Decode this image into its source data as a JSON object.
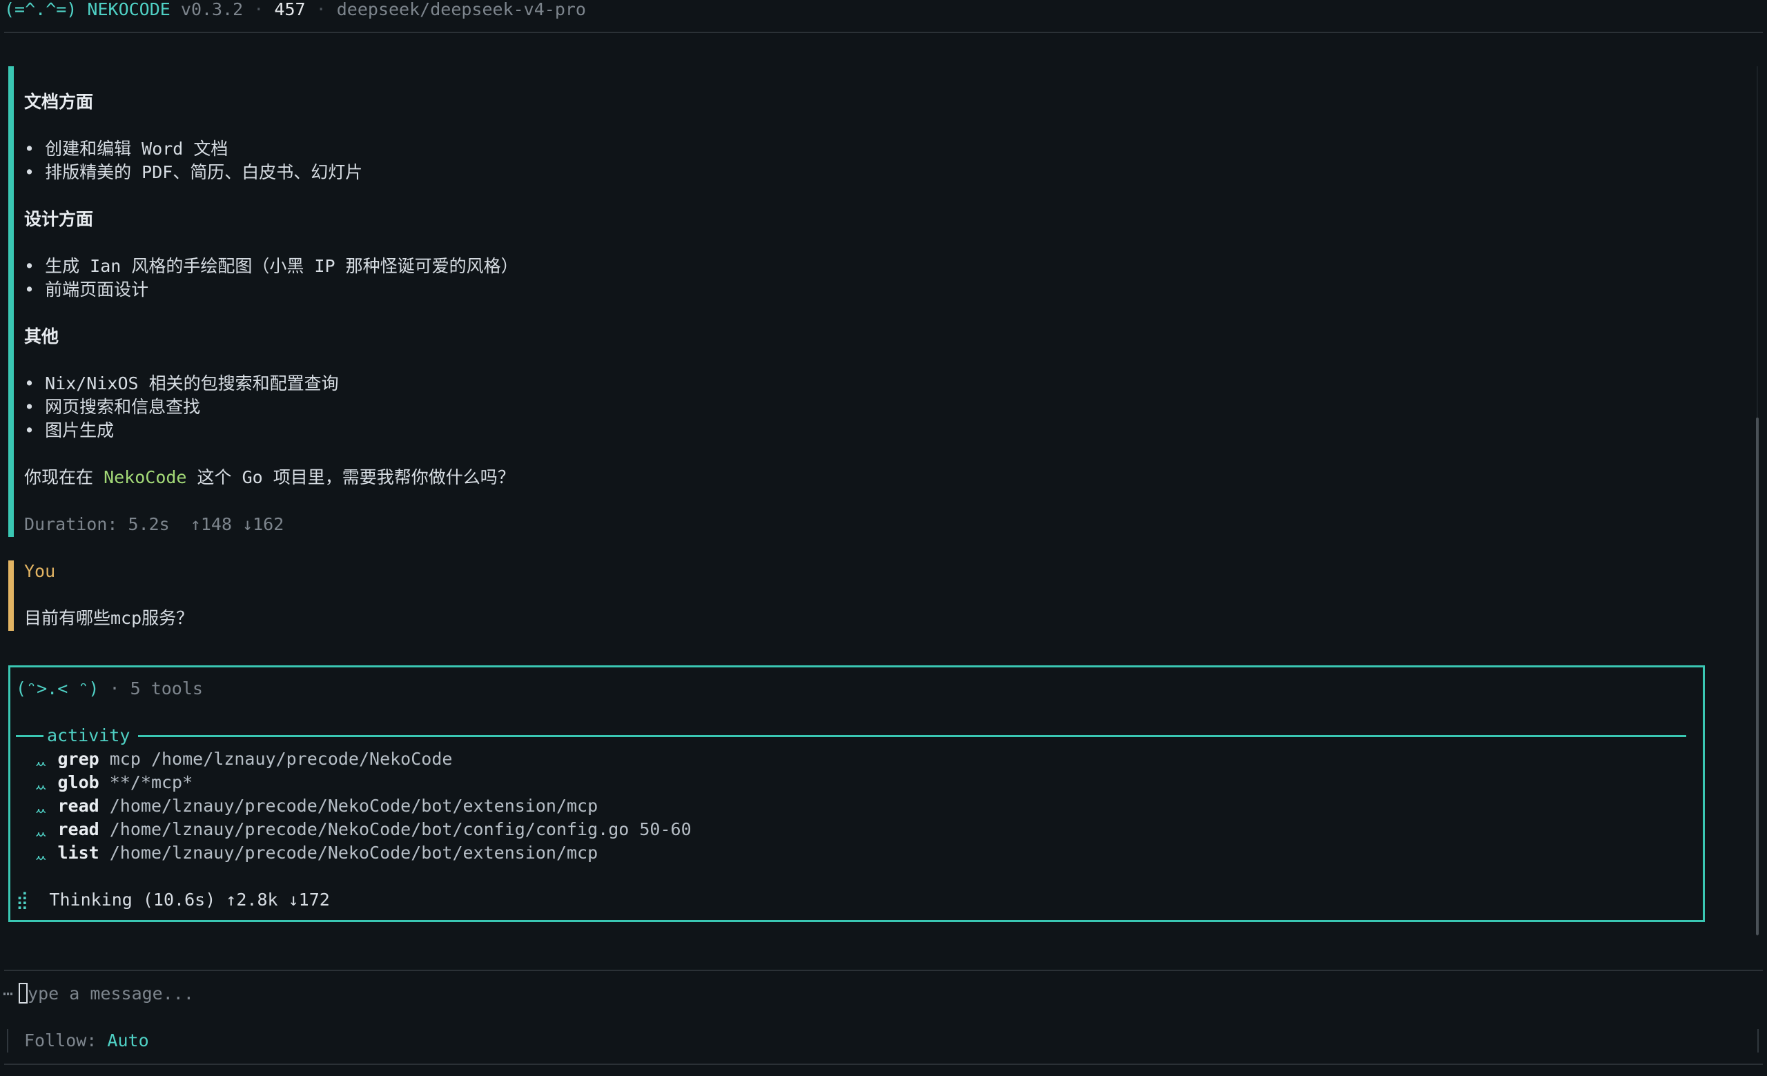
{
  "header": {
    "face": "(=^.^=)",
    "brand": "NEKOCODE",
    "version": "v0.3.2",
    "separator": "·",
    "count": "457",
    "model": "deepseek/deepseek-v4-pro"
  },
  "assistant_message": {
    "sections": [
      {
        "title": "文档方面",
        "items": [
          "• 创建和编辑 Word 文档",
          "• 排版精美的 PDF、简历、白皮书、幻灯片"
        ]
      },
      {
        "title": "设计方面",
        "items": [
          "• 生成 Ian 风格的手绘配图（小黑 IP 那种怪诞可爱的风格）",
          "• 前端页面设计"
        ]
      },
      {
        "title": "其他",
        "items": [
          "• Nix/NixOS 相关的包搜索和配置查询",
          "• 网页搜索和信息查找",
          "• 图片生成"
        ]
      }
    ],
    "closing_prefix": "你现在在 ",
    "closing_highlight": "NekoCode",
    "closing_suffix": " 这个 Go 项目里，需要我帮你做什么吗？",
    "duration": "Duration: 5.2s  ↑148 ↓162"
  },
  "user_message": {
    "author": "You",
    "text": "目前有哪些mcp服务？"
  },
  "activity_panel": {
    "face": "(ᵔ>.< ᵔ)",
    "tools_summary": "· 5 tools",
    "title": "activity",
    "tool_icon": "ᆻ",
    "tools": [
      {
        "name": "grep",
        "args": "mcp /home/lznauy/precode/NekoCode"
      },
      {
        "name": "glob",
        "args": "**/*mcp*"
      },
      {
        "name": "read",
        "args": "/home/lznauy/precode/NekoCode/bot/extension/mcp"
      },
      {
        "name": "read",
        "args": "/home/lznauy/precode/NekoCode/bot/config/config.go 50-60"
      },
      {
        "name": "list",
        "args": "/home/lznauy/precode/NekoCode/bot/extension/mcp"
      }
    ],
    "spinner": "⣾",
    "thinking": "Thinking (10.6s) ↑2.8k ↓172"
  },
  "input": {
    "prefix": "⋯",
    "placeholder": "ype a message..."
  },
  "status": {
    "follow_label": "Follow: ",
    "follow_value": "Auto"
  },
  "colors": {
    "background": "#0f1418",
    "accent": "#3ac7b3",
    "assistant_bar": "#3ac7b3",
    "user_bar": "#e2b463",
    "highlight": "#a3d977"
  }
}
